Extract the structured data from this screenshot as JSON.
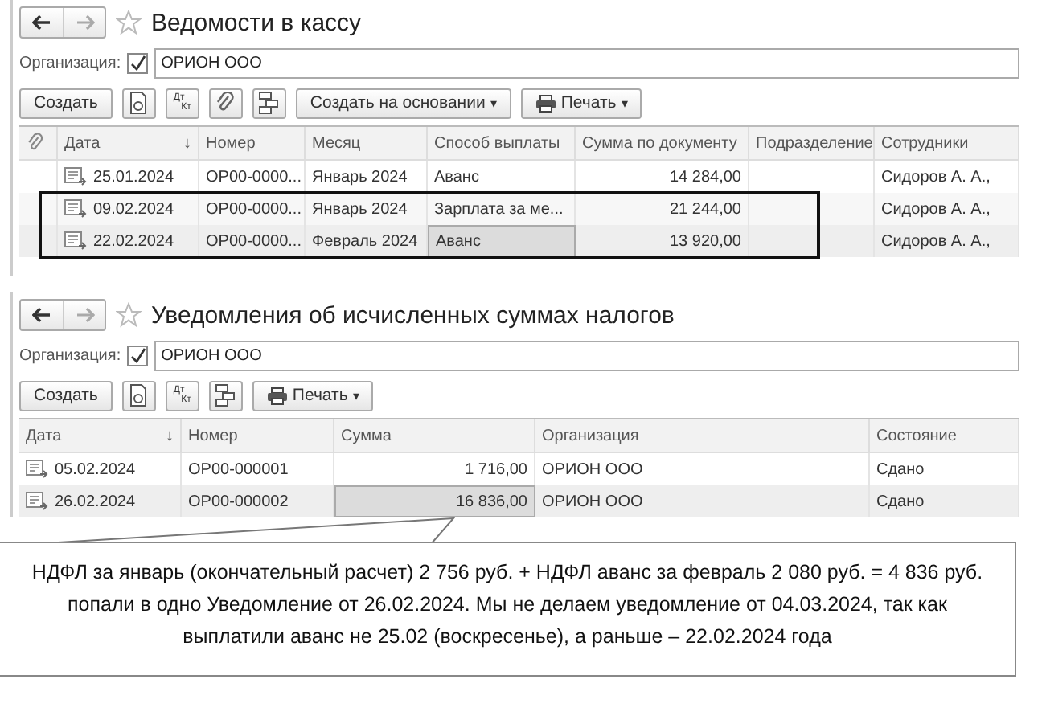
{
  "windows": [
    {
      "title": "Ведомости в кассу",
      "org_label": "Организация:",
      "org_checked": true,
      "org_value": "ОРИОН ООО",
      "toolbar": [
        {
          "kind": "button",
          "label": "Создать"
        },
        {
          "kind": "copy"
        },
        {
          "kind": "dtkt",
          "top": "Дт",
          "bottom": "Кт"
        },
        {
          "kind": "clip"
        },
        {
          "kind": "struct"
        },
        {
          "kind": "dropdown",
          "label": "Создать на основании",
          "caret": "▾"
        },
        {
          "kind": "print",
          "label": "Печать",
          "caret": "▾"
        }
      ],
      "columns": [
        {
          "kind": "attach",
          "current": false
        },
        {
          "kind": "date",
          "label": "Дата",
          "sort": "↓",
          "current": false
        },
        {
          "kind": "text",
          "label": "Номер",
          "current": false
        },
        {
          "kind": "text",
          "label": "Месяц",
          "current": false
        },
        {
          "kind": "text",
          "label": "Способ выплаты",
          "current": true
        },
        {
          "kind": "number",
          "label": "Сумма по документу",
          "current": false
        },
        {
          "kind": "text",
          "label": "Подразделение",
          "current": false
        },
        {
          "kind": "text",
          "label": "Сотрудники",
          "current": false
        }
      ],
      "rows": [
        {
          "selected": false,
          "framed": false,
          "cells": [
            "",
            "25.01.2024",
            "ОР00-0000...",
            "Январь 2024",
            "Аванс",
            "14 284,00",
            "",
            "Сидоров А. А.,"
          ]
        },
        {
          "selected": false,
          "framed": true,
          "cells": [
            "",
            "09.02.2024",
            "ОР00-0000...",
            "Январь 2024",
            "Зарплата за ме...",
            "21 244,00",
            "",
            "Сидоров А. А.,"
          ]
        },
        {
          "selected": true,
          "framed": true,
          "cells": [
            "",
            "22.02.2024",
            "ОР00-0000...",
            "Февраль 2024",
            "Аванс",
            "13 920,00",
            "",
            "Сидоров А. А.,"
          ]
        }
      ]
    },
    {
      "title": "Уведомления об исчисленных суммах налогов",
      "org_label": "Организация:",
      "org_checked": true,
      "org_value": "ОРИОН ООО",
      "toolbar": [
        {
          "kind": "button",
          "label": "Создать"
        },
        {
          "kind": "copy"
        },
        {
          "kind": "dtkt",
          "top": "Дт",
          "bottom": "Кт"
        },
        {
          "kind": "struct"
        },
        {
          "kind": "print",
          "label": "Печать",
          "caret": "▾"
        }
      ],
      "columns": [
        {
          "kind": "date",
          "label": "Дата",
          "sort": "↓",
          "current": false
        },
        {
          "kind": "text",
          "label": "Номер",
          "current": false
        },
        {
          "kind": "number",
          "label": "Сумма",
          "current": true
        },
        {
          "kind": "text",
          "label": "Организация",
          "current": false
        },
        {
          "kind": "text",
          "label": "Состояние",
          "current": false
        }
      ],
      "rows": [
        {
          "selected": false,
          "framed": false,
          "cells": [
            "05.02.2024",
            "ОР00-000001",
            "1 716,00",
            "ОРИОН ООО",
            "Сдано"
          ]
        },
        {
          "selected": true,
          "framed": false,
          "cells": [
            "26.02.2024",
            "ОР00-000002",
            "16 836,00",
            "ОРИОН ООО",
            "Сдано"
          ]
        }
      ]
    }
  ],
  "callout": {
    "text": "НДФЛ за январь (окончательный расчет) 2 756 руб.  + НДФЛ аванс за февраль 2 080 руб. =  4 836 руб. попали в одно Уведомление от  26.02.2024.  Мы не делаем уведомление от 04.03.2024,  так как выплатили аванс не 25.02  (воскресенье), а раньше – 22.02.2024  года"
  }
}
